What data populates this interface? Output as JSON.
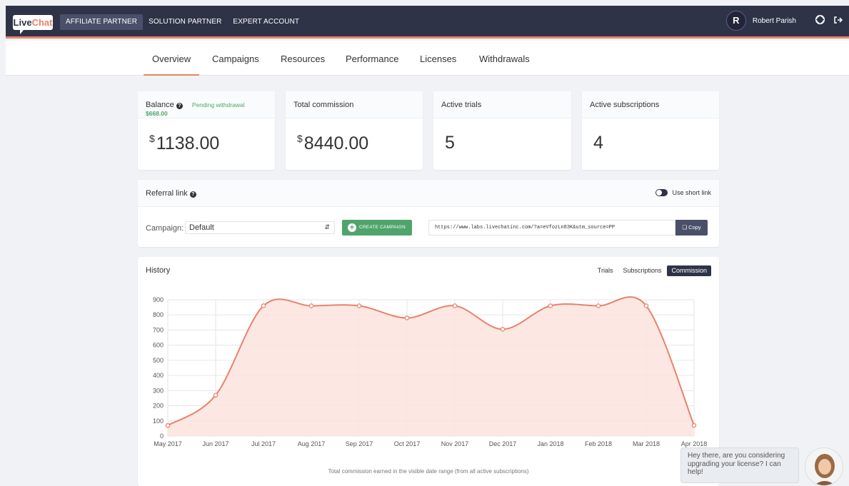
{
  "topbar": {
    "logo_live": "Live",
    "logo_chat": "Chat",
    "nav": [
      "AFFILIATE PARTNER",
      "SOLUTION PARTNER",
      "EXPERT ACCOUNT"
    ],
    "user_initial": "R",
    "user_name": "Robert Parish",
    "accent": "#e8826b",
    "bg": "#2f3347"
  },
  "subnav": {
    "tabs": [
      "Overview",
      "Campaigns",
      "Resources",
      "Performance",
      "Licenses",
      "Withdrawals"
    ],
    "active": "Overview"
  },
  "stats": {
    "balance": {
      "label": "Balance",
      "pending_label": "Pending withdrawal",
      "pending_value": "$668.00",
      "currency": "$",
      "value": "1138.00"
    },
    "commission": {
      "label": "Total commission",
      "currency": "$",
      "value": "8440.00"
    },
    "trials": {
      "label": "Active trials",
      "value": "5"
    },
    "subscriptions": {
      "label": "Active subscriptions",
      "value": "4"
    }
  },
  "referral": {
    "title": "Referral link",
    "short_link_label": "Use short link",
    "campaign_label": "Campaign:",
    "campaign_value": "Default",
    "create_label": "CREATE CAMPAIGN",
    "url": "https://www.labs.livechatinc.com/?a=eVfozLn83K&utm_source=PP",
    "copy_label": "Copy"
  },
  "history": {
    "title": "History",
    "filters": [
      "Trials",
      "Subscriptions",
      "Commission"
    ],
    "active_filter": "Commission",
    "caption": "Total commission earned in the visible date range (from all active subscriptions)"
  },
  "chart_data": {
    "type": "area",
    "x": [
      "May 2017",
      "Jun 2017",
      "Jul 2017",
      "Aug 2017",
      "Sep 2017",
      "Oct 2017",
      "Nov 2017",
      "Dec 2017",
      "Jan 2018",
      "Feb 2018",
      "Mar 2018",
      "Apr 2018"
    ],
    "series": [
      {
        "values": [
          70,
          270,
          860,
          860,
          860,
          780,
          860,
          705,
          860,
          860,
          860,
          70
        ]
      }
    ],
    "y_ticks": [
      0,
      100,
      200,
      300,
      400,
      500,
      600,
      700,
      800,
      900
    ],
    "ylim": [
      0,
      900
    ],
    "grid": true,
    "line_color": "#e8826b",
    "fill_color": "#fbe3de"
  },
  "chat": {
    "message": "Hey there, are you considering upgrading your license? I can help!"
  }
}
